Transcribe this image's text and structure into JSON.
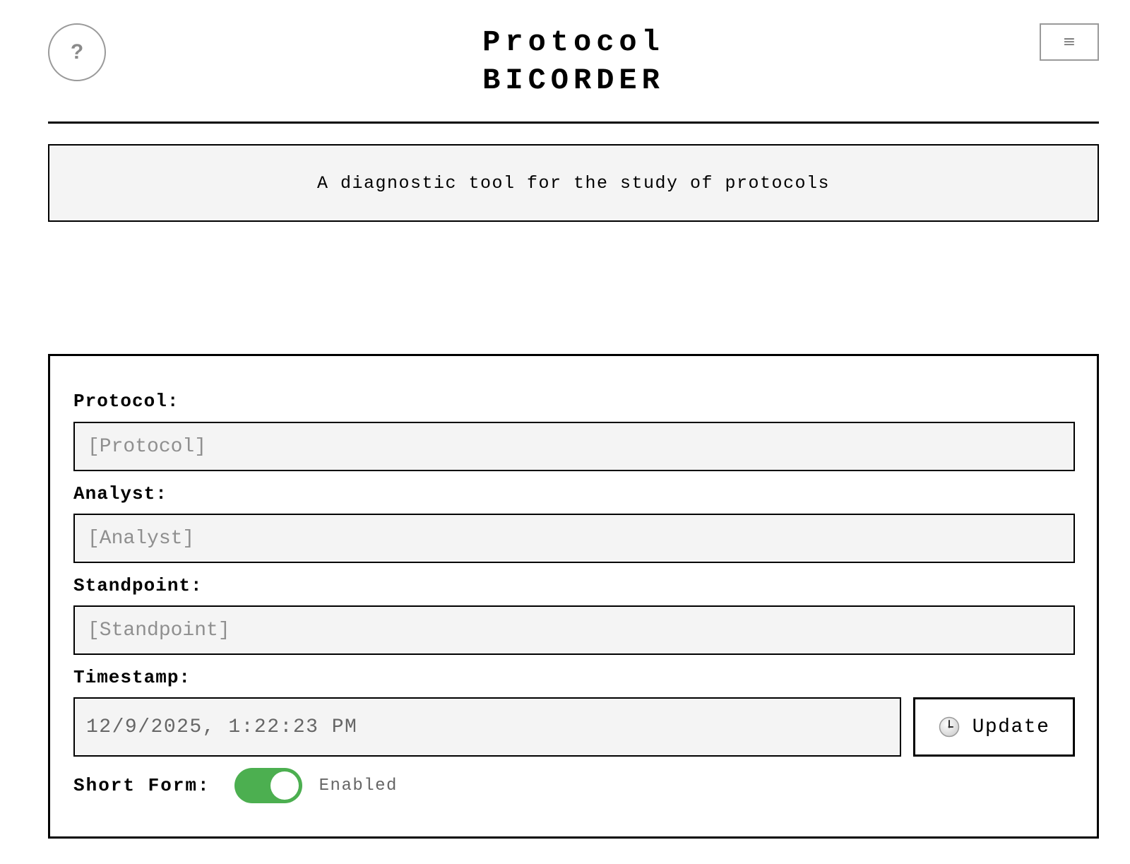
{
  "header": {
    "help_label": "?",
    "title_line1": "Protocol",
    "title_line2": "BICORDER",
    "menu_label": "≡"
  },
  "tagline": "A diagnostic tool for the study of protocols",
  "form": {
    "protocol": {
      "label": "Protocol:",
      "placeholder": "[Protocol]",
      "value": ""
    },
    "analyst": {
      "label": "Analyst:",
      "placeholder": "[Analyst]",
      "value": ""
    },
    "standpoint": {
      "label": "Standpoint:",
      "placeholder": "[Standpoint]",
      "value": ""
    },
    "timestamp": {
      "label": "Timestamp:",
      "value": "12/9/2025, 1:22:23 PM",
      "update_label": "Update",
      "update_icon": "clock-icon"
    },
    "short_form": {
      "label": "Short Form:",
      "enabled": true,
      "state_label": "Enabled"
    }
  },
  "colors": {
    "toggle_on": "#4caf50",
    "input_bg": "#f4f4f4",
    "border": "#000000"
  }
}
